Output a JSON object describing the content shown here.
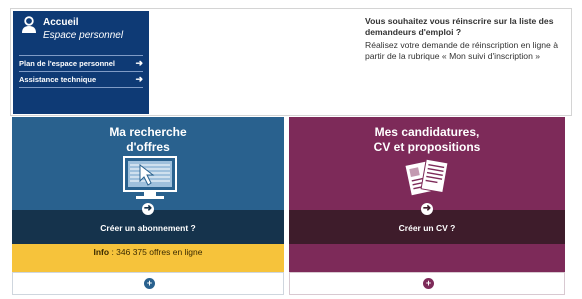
{
  "sidebar": {
    "title": "Accueil",
    "subtitle": "Espace personnel",
    "links": [
      {
        "label": "Plan de l'espace personnel"
      },
      {
        "label": "Assistance technique"
      }
    ]
  },
  "notice": {
    "question": "Vous souhaitez vous réinscrire sur la liste des demandeurs d'emploi ?",
    "body": "Réalisez votre demande de réinscription en ligne à partir de la rubrique « Mon suivi d'inscription »"
  },
  "cards": [
    {
      "title_line1": "Ma recherche",
      "title_line2": "d'offres",
      "action": "Créer un abonnement ?",
      "info_label": "Info",
      "info_text": " : 346 375 offres en ligne",
      "color": "#29618e"
    },
    {
      "title_line1": "Mes candidatures,",
      "title_line2": "CV et propositions",
      "action": "Créer un CV ?",
      "color": "#7d2a59"
    }
  ],
  "icons": {
    "user": "user-icon",
    "arrow": "arrow-right-icon",
    "computer": "computer-click-icon",
    "documents": "documents-icon",
    "plus": "plus-icon"
  }
}
